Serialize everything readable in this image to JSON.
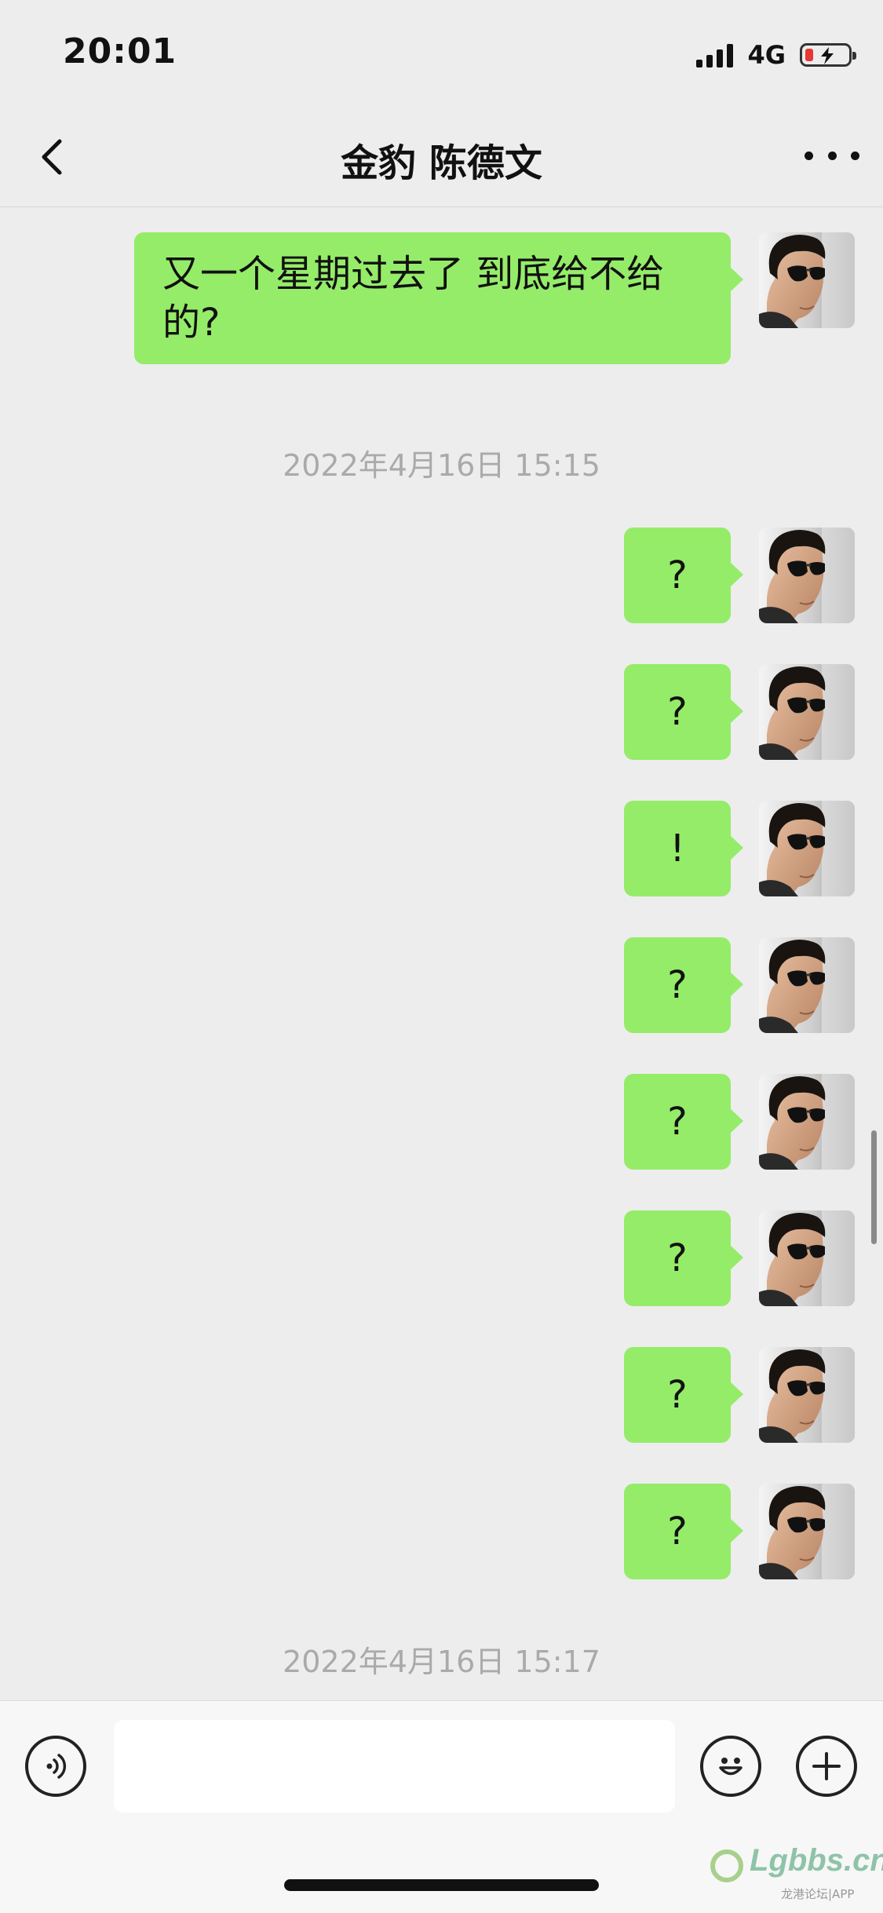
{
  "status_bar": {
    "time": "20:01",
    "network": "4G"
  },
  "nav": {
    "title": "金豹 陈德文"
  },
  "messages": [
    {
      "text": "又一个星期过去了 到底给不给的?"
    },
    {
      "text": "?"
    },
    {
      "text": "?"
    },
    {
      "text": "!"
    },
    {
      "text": "?"
    },
    {
      "text": "?"
    },
    {
      "text": "?"
    },
    {
      "text": "?"
    },
    {
      "text": "?"
    }
  ],
  "timestamps": [
    "2022年4月16日 15:15",
    "2022年4月16日 15:17"
  ],
  "input": {
    "value": "",
    "placeholder": ""
  },
  "watermark": {
    "logo": "Lgbbs.cn",
    "sub": "龙港论坛|APP"
  },
  "colors": {
    "bubble": "#95ec69",
    "background": "#ededed",
    "input_bar": "#f7f7f7"
  },
  "icons": [
    "back-arrow-icon",
    "more-dots-icon",
    "voice-icon",
    "emoji-icon",
    "plus-icon"
  ]
}
